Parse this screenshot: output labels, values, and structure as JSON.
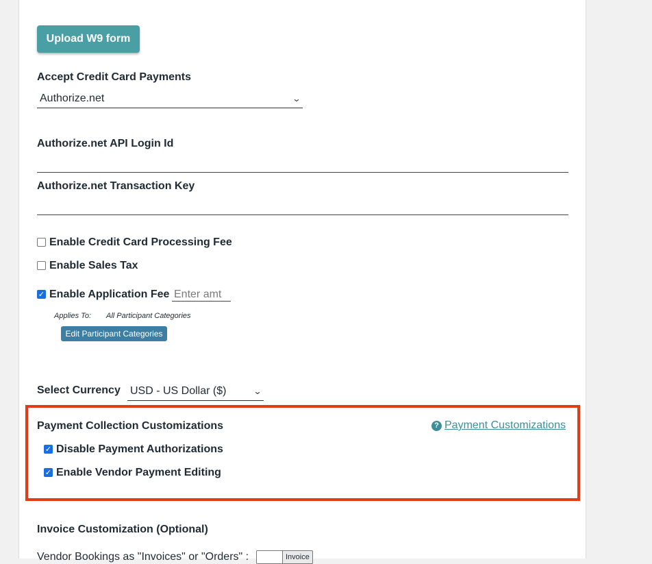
{
  "upload": {
    "label": "Upload W9 form"
  },
  "credit_card": {
    "label": "Accept Credit Card Payments",
    "selected": "Authorize.net"
  },
  "api_login": {
    "label": "Authorize.net API Login Id",
    "value": ""
  },
  "transaction_key": {
    "label": "Authorize.net Transaction Key",
    "value": ""
  },
  "options": {
    "processing_fee": {
      "label": "Enable Credit Card Processing Fee",
      "checked": false
    },
    "sales_tax": {
      "label": "Enable Sales Tax",
      "checked": false
    },
    "application_fee": {
      "label": "Enable Application Fee",
      "checked": true,
      "placeholder": "Enter amt"
    }
  },
  "applies_to": {
    "label": "Applies To:",
    "value": "All Participant Categories",
    "edit_button": "Edit Participant Categories"
  },
  "currency": {
    "label": "Select Currency",
    "selected": "USD - US Dollar ($)"
  },
  "payment_collection": {
    "title": "Payment Collection Customizations",
    "help_link": "Payment Customizations",
    "disable_authorizations": {
      "label": "Disable Payment Authorizations",
      "checked": true
    },
    "vendor_editing": {
      "label": "Enable Vendor Payment Editing",
      "checked": true
    }
  },
  "invoice": {
    "title": "Invoice Customization (Optional)",
    "bookings_label": "Vendor Bookings as \"Invoices\" or \"Orders\" :",
    "toggle_value": "Invoice"
  },
  "colors": {
    "accent": "#4a9fa5",
    "highlight_border": "#e23b17",
    "link": "#3d8e99",
    "checkbox": "#1a6fe0"
  }
}
